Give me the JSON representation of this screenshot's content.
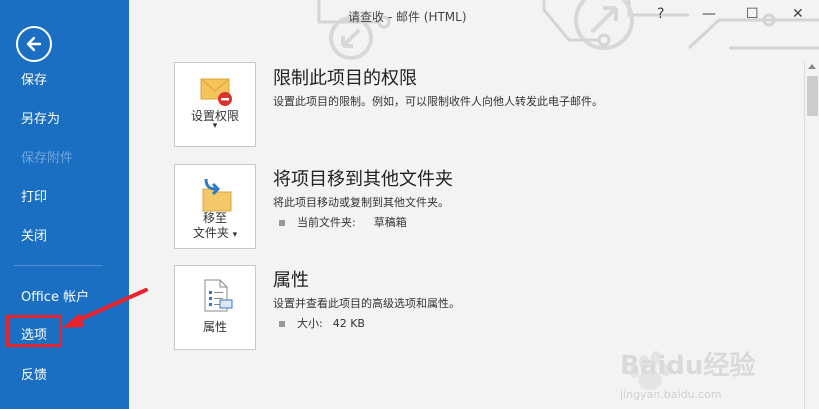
{
  "window": {
    "title": "请查收 - 邮件 (HTML)",
    "help": "?",
    "minimize": "—",
    "maximize": "☐",
    "close": "✕"
  },
  "sidebar": {
    "items": [
      {
        "label": "保存",
        "enabled": true
      },
      {
        "label": "另存为",
        "enabled": true
      },
      {
        "label": "保存附件",
        "enabled": false
      },
      {
        "label": "打印",
        "enabled": true
      },
      {
        "label": "关闭",
        "enabled": true
      },
      {
        "label": "Office 帐户",
        "enabled": true
      },
      {
        "label": "选项",
        "enabled": true
      },
      {
        "label": "反馈",
        "enabled": true
      }
    ]
  },
  "sections": {
    "permission": {
      "button_label": "设置权限",
      "title": "限制此项目的权限",
      "desc": "设置此项目的限制。例如，可以限制收件人向他人转发此电子邮件。"
    },
    "move": {
      "button_line1": "移至",
      "button_line2": "文件夹",
      "title": "将项目移到其他文件夹",
      "desc": "将此项目移动或复制到其他文件夹。",
      "current_folder_label": "当前文件夹:",
      "current_folder_value": "草稿箱"
    },
    "properties": {
      "button_label": "属性",
      "title": "属性",
      "desc": "设置并查看此项目的高级选项和属性。",
      "size_label": "大小:",
      "size_value": "42 KB"
    }
  },
  "watermark": {
    "brand": "Baidu经验",
    "url": "jingyan.baidu.com"
  },
  "colors": {
    "sidebar": "#1a6fc2",
    "annotation": "#e8232b"
  }
}
